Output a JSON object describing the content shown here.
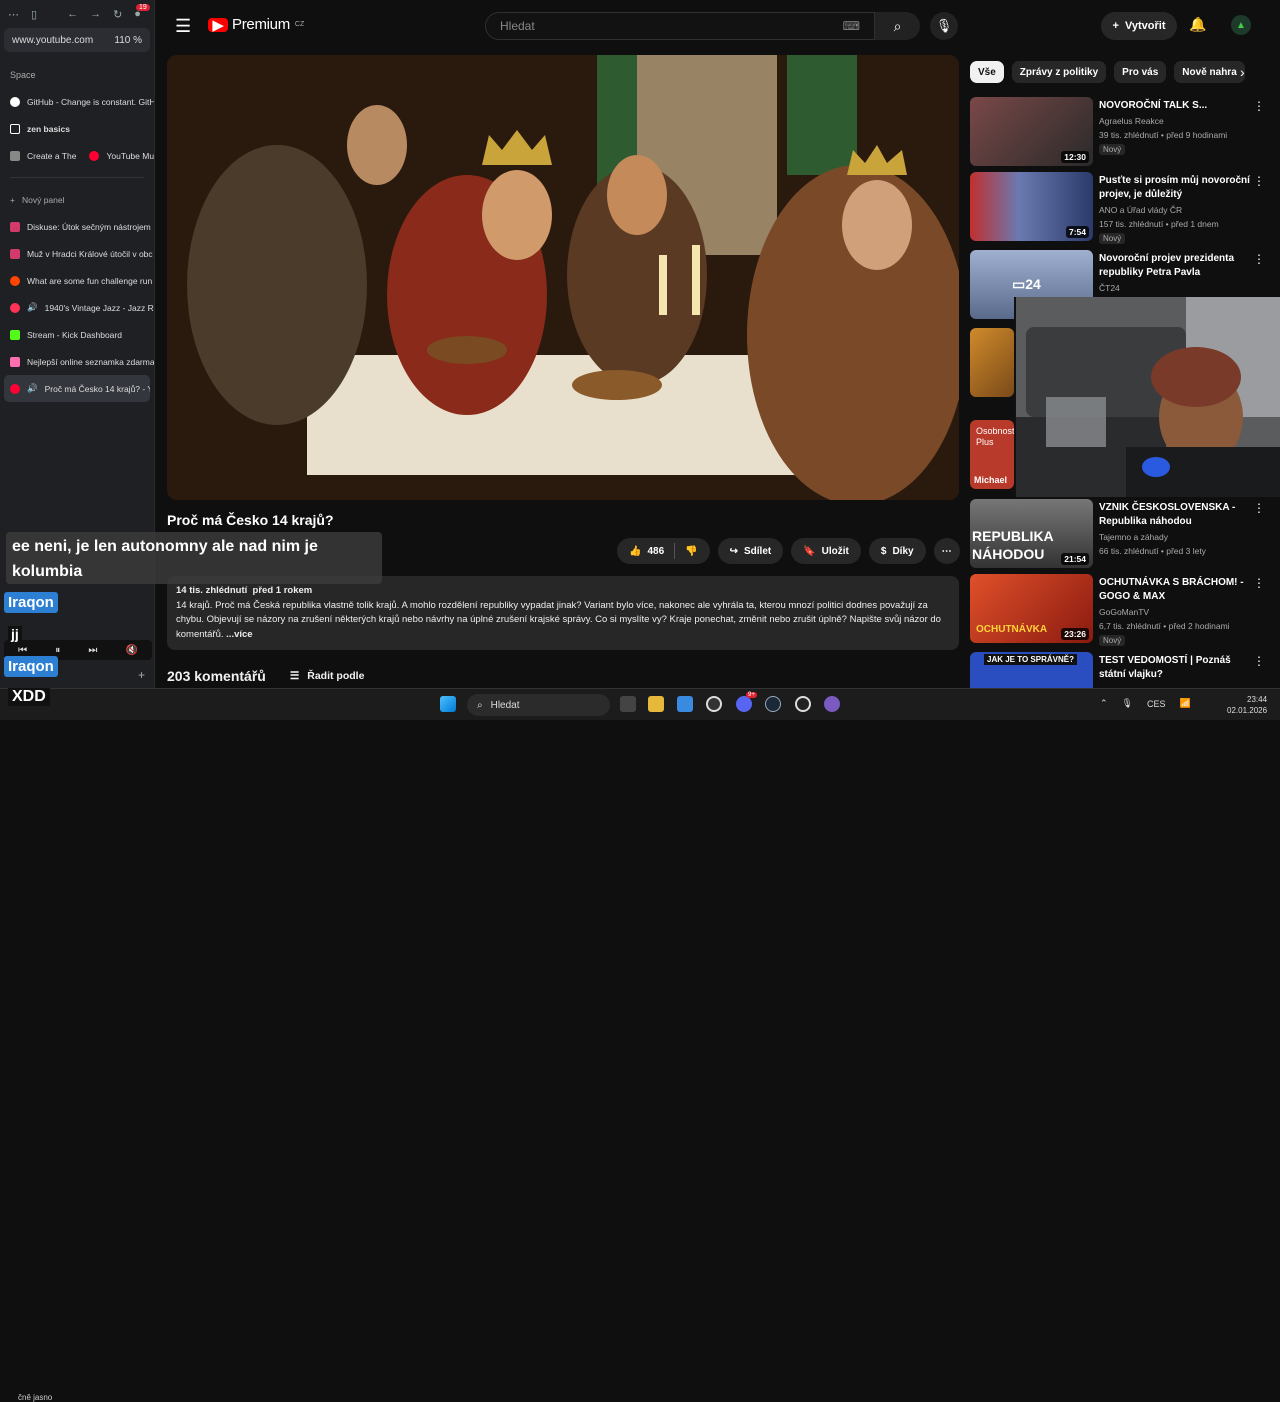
{
  "browser": {
    "url": "www.youtube.com",
    "zoom": "110 %",
    "notification_count": "19",
    "space_label": "Space",
    "pinned": [
      {
        "label": "GitHub - Change is constant. GitH",
        "color": "#ffffff"
      },
      {
        "label": "zen basics",
        "color": "#ffffff"
      },
      {
        "label": "Create a The",
        "second": "YouTube Mu",
        "color": "#888888"
      }
    ],
    "new_panel": "Nový panel",
    "tabs": [
      {
        "label": "Diskuse: Útok sečným nástrojem",
        "color": "#d23a6a"
      },
      {
        "label": "Muž v Hradci Králové útočil v obc",
        "color": "#d23a6a"
      },
      {
        "label": "What are some fun challenge run",
        "color": "#ff4500"
      },
      {
        "label": "1940's Vintage Jazz - Jazz Ret",
        "color": "#ff3355",
        "audio": true
      },
      {
        "label": "Stream - Kick Dashboard",
        "color": "#53fc18"
      },
      {
        "label": "Nejlepší online seznamka zdarma",
        "color": "#ff6fae"
      },
      {
        "label": "Proč má Česko 14 krajů? - Yo",
        "color": "#ff0033",
        "audio": true
      }
    ],
    "weather": "čně jasno"
  },
  "youtube": {
    "logo_text": "Premium",
    "region": "CZ",
    "search_placeholder": "Hledat",
    "create_label": "Vytvořit",
    "video_title": "Proč má Česko 14 krajů?",
    "likes": "486",
    "share_label": "Sdílet",
    "save_label": "Uložit",
    "thanks_label": "Díky",
    "views": "14 tis. zhlédnutí",
    "age": "před 1 rokem",
    "description": "14 krajů. Proč má Česká republika vlastně tolik krajů. A mohlo rozdělení republiky vypadat jinak? Variant bylo více, nakonec ale vyhrála ta, kterou mnozí politici dodnes považují za chybu. Objevují se názory na zrušení některých krajů nebo návrhy na úplné zrušení krajské správy. Co si myslíte vy? Kraje ponechat, změnit nebo zrušit úplně? Napište svůj názor do komentářů.",
    "more_label": "...více",
    "comments_count": "203 komentářů",
    "sort_label": "Řadit podle",
    "chips": [
      "Vše",
      "Zprávy z politiky",
      "Pro vás",
      "Nově nahra"
    ],
    "recommendations": [
      {
        "title": "NOVOROČNÍ TALK S...",
        "channel": "Agraelus Reakce",
        "meta": "39 tis. zhlédnutí • před 9 hodinami",
        "duration": "12:30",
        "new": "Nový",
        "thumb": "#6b3a3a"
      },
      {
        "title": "Pusťte si prosím můj novoroční projev, je důležitý",
        "channel": "ANO a Úřad vlády ČR",
        "meta": "157 tis. zhlédnutí • před 1 dnem",
        "duration": "7:54",
        "new": "Nový",
        "thumb": "#3a4a6b"
      },
      {
        "title": "Novoroční projev prezidenta republiky Petra Pavla",
        "channel": "ČT24",
        "meta": "",
        "duration": "",
        "new": "",
        "thumb": "#6b7aa0"
      },
      {
        "title": "VZNIK ČESKOSLOVENSKA - Republika náhodou",
        "channel": "Tajemno a záhady",
        "meta": "66 tis. zhlédnutí • před 3 lety",
        "duration": "21:54",
        "new": "",
        "thumb": "#555555",
        "thumb_text": "REPUBLIKA NÁHODOU"
      },
      {
        "title": "OCHUTNÁVKA S BRÁCHOM! - GOGO & MAX",
        "channel": "GoGoManTV",
        "meta": "6,7 tis. zhlédnutí • před 2 hodinami",
        "duration": "23:26",
        "new": "Nový",
        "thumb": "#c4341a",
        "thumb_text": "OCHUTNÁVKA"
      },
      {
        "title": "TEST VEDOMOSTÍ | Poznáš státní vlajku?",
        "channel": "",
        "meta": "",
        "duration": "",
        "new": "",
        "thumb": "#2a4ec0",
        "thumb_text": "JAK JE TO SPRÁVNĚ?"
      }
    ],
    "partial_thumb_text": "Osobnost Plus",
    "partial_name": "Michael"
  },
  "overlay": {
    "chat_text": "ee neni, je len autonomny ale nad nim je kolumbia",
    "tag1": "Iraqon",
    "tag2": "Iraqon",
    "jj": "jj",
    "xdd": "XDD"
  },
  "taskbar": {
    "search": "Hledat",
    "lang": "CES",
    "time": "23:44",
    "date": "02.01.2026",
    "discord_badge": "9+"
  }
}
